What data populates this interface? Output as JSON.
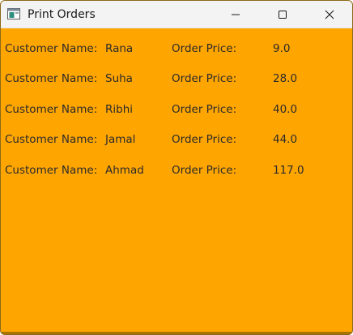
{
  "window": {
    "title": "Print Orders",
    "controls": {
      "minimize": "minimize-icon",
      "maximize": "maximize-icon",
      "close": "close-icon"
    }
  },
  "labels": {
    "customer_name": "Customer Name:",
    "order_price": "Order Price:"
  },
  "orders": [
    {
      "customer": "Rana",
      "price": "9.0"
    },
    {
      "customer": "Suha",
      "price": "28.0"
    },
    {
      "customer": "Ribhi",
      "price": "40.0"
    },
    {
      "customer": "Jamal",
      "price": "44.0"
    },
    {
      "customer": "Ahmad",
      "price": "117.0"
    }
  ],
  "colors": {
    "background": "#ffa500",
    "titlebar": "#f3f3f3"
  }
}
